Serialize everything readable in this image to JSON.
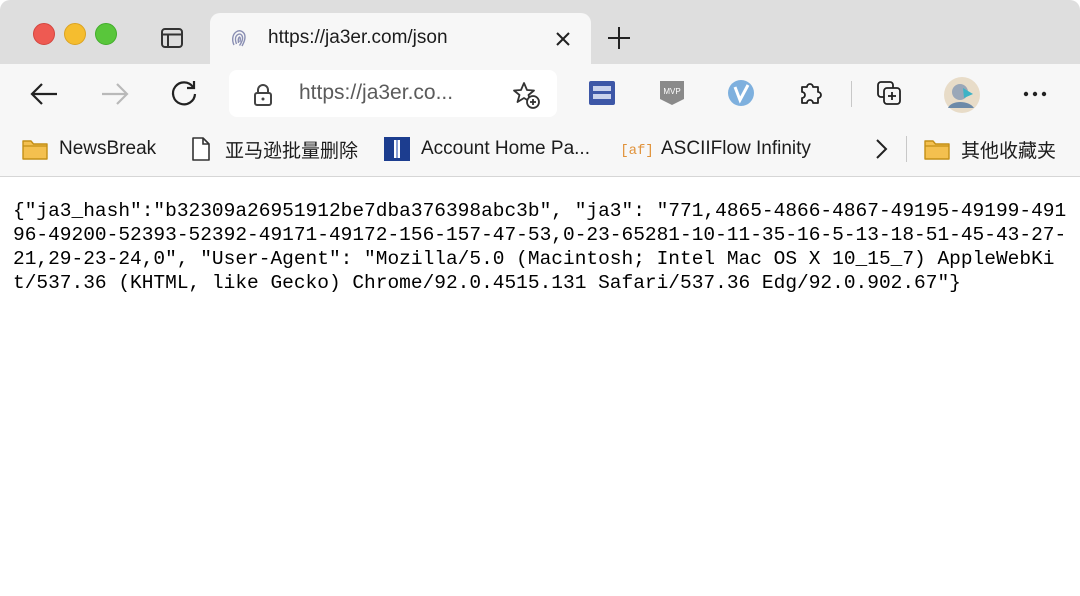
{
  "tab": {
    "title": "https://ja3er.com/json"
  },
  "toolbar": {
    "address_text": "https://ja3er.co..."
  },
  "bookmarks": [
    {
      "label": "NewsBreak",
      "icon": "folder-icon"
    },
    {
      "label": "亚马逊批量删除",
      "icon": "page-icon"
    },
    {
      "label": "Account Home Pa...",
      "icon": "account-bookmark-icon"
    },
    {
      "label": "ASCIIFlow Infinity",
      "icon": "asciiflow-icon"
    },
    {
      "label": "其他收藏夹",
      "icon": "folder-icon"
    }
  ],
  "content": {
    "json_text": "{\"ja3_hash\":\"b32309a26951912be7dba376398abc3b\", \"ja3\": \"771,4865-4866-4867-49195-49199-49196-49200-52393-52392-49171-49172-156-157-47-53,0-23-65281-10-11-35-16-5-13-18-51-45-43-27-21,29-23-24,0\", \"User-Agent\": \"Mozilla/5.0 (Macintosh; Intel Mac OS X 10_15_7) AppleWebKit/537.36 (KHTML, like Gecko) Chrome/92.0.4515.131 Safari/537.36 Edg/92.0.902.67\"}"
  },
  "colors": {
    "tabstrip_bg": "#dedede",
    "toolbar_bg": "#f7f7f7",
    "close_button": "#ee5a52",
    "minimize_button": "#f5bd2f",
    "maximize_button": "#59c63b"
  }
}
